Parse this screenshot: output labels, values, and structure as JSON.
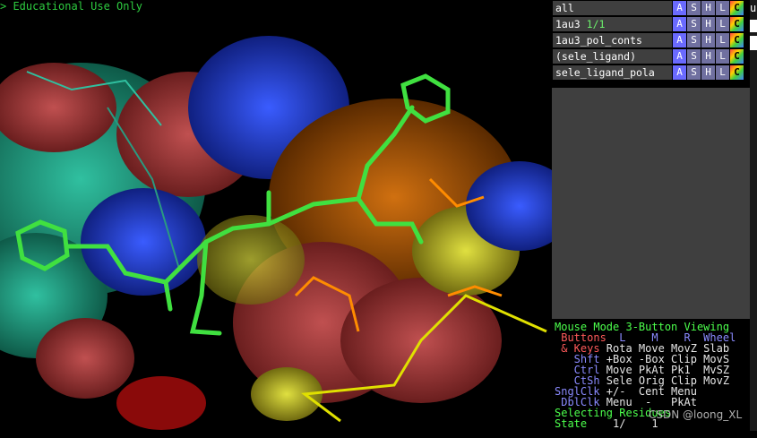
{
  "viewport": {
    "banner": "> Educational Use Only"
  },
  "watermark": "CSDN @loong_XL",
  "object_panel": {
    "rows": [
      {
        "name": "all",
        "state": ""
      },
      {
        "name": "1au3",
        "state": "1/1"
      },
      {
        "name": "1au3_pol_conts",
        "state": ""
      },
      {
        "name": "(sele_ligand)",
        "state": ""
      },
      {
        "name": "sele_ligand_pola",
        "state": ""
      }
    ],
    "buttons": [
      "A",
      "S",
      "H",
      "L",
      "C"
    ]
  },
  "right_strip": {
    "letter": "u"
  },
  "mouse_mode": {
    "title": "Mouse Mode 3-Button Viewing",
    "header_left": " Buttons",
    "header_cols": "  L    M    R  Wheel",
    "keys_label": " & Keys",
    "keys_row": " Rota Move MovZ Slab",
    "shft_label": "   Shft",
    "shft_row": " +Box -Box Clip MovS",
    "ctrl_label": "   Ctrl",
    "ctrl_row": " Move PkAt Pk1  MvSZ",
    "ctsh_label": "   CtSh",
    "ctsh_row": " Sele Orig Clip MovZ",
    "sngl_label": "SnglClk",
    "sngl_row": " +/-  Cent Menu",
    "dbl_label": " DblClk",
    "dbl_row": " Menu  -   PkAt",
    "selecting": "Selecting Residues",
    "state_label": "State",
    "state_value": "    1/    1"
  },
  "colors": {
    "panel_bg": "#3f3f3f",
    "accent_green": "#4cff4c",
    "accent_red": "#ff5a5a",
    "accent_blue": "#8a8aff"
  }
}
